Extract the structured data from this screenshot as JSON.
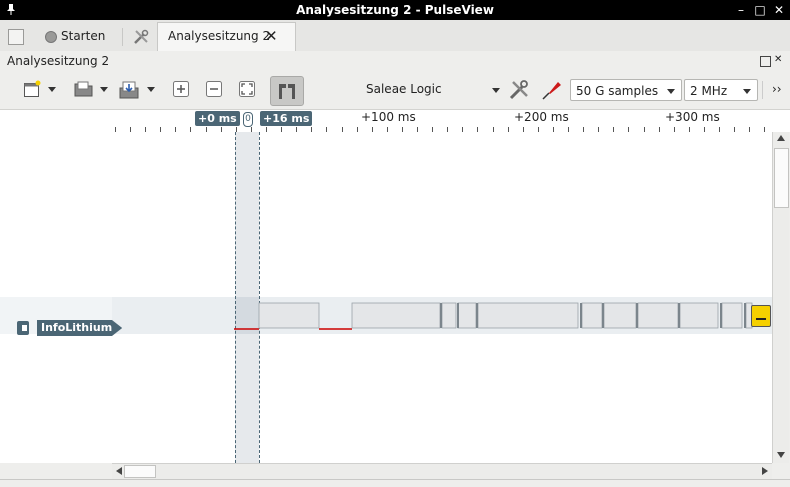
{
  "window": {
    "title": "Analysesitzung 2 - PulseView",
    "controls": [
      "–",
      "□",
      "✕"
    ]
  },
  "tabs": {
    "start_label": "Starten",
    "session_label": "Analysesitzung 2",
    "close_glyph": "✕"
  },
  "session": {
    "title": "Analysesitzung 2"
  },
  "toolbar": {
    "device": "Saleae Logic",
    "samples": "50 G samples",
    "samplerate": "2 MHz",
    "more_glyph": "››"
  },
  "ruler": {
    "labels": [
      "+100 ms",
      "+200 ms",
      "+300 ms"
    ],
    "cursor_left": "+0 ms",
    "cursor_right": "+16 ms",
    "cursor_handle": "0"
  },
  "channels": [
    {
      "name": "InfoLithium",
      "color": "#4b6675"
    }
  ],
  "colors": {
    "accent": "#4b6675",
    "signal_low": "#cc0000",
    "marker": "#f5d000"
  }
}
